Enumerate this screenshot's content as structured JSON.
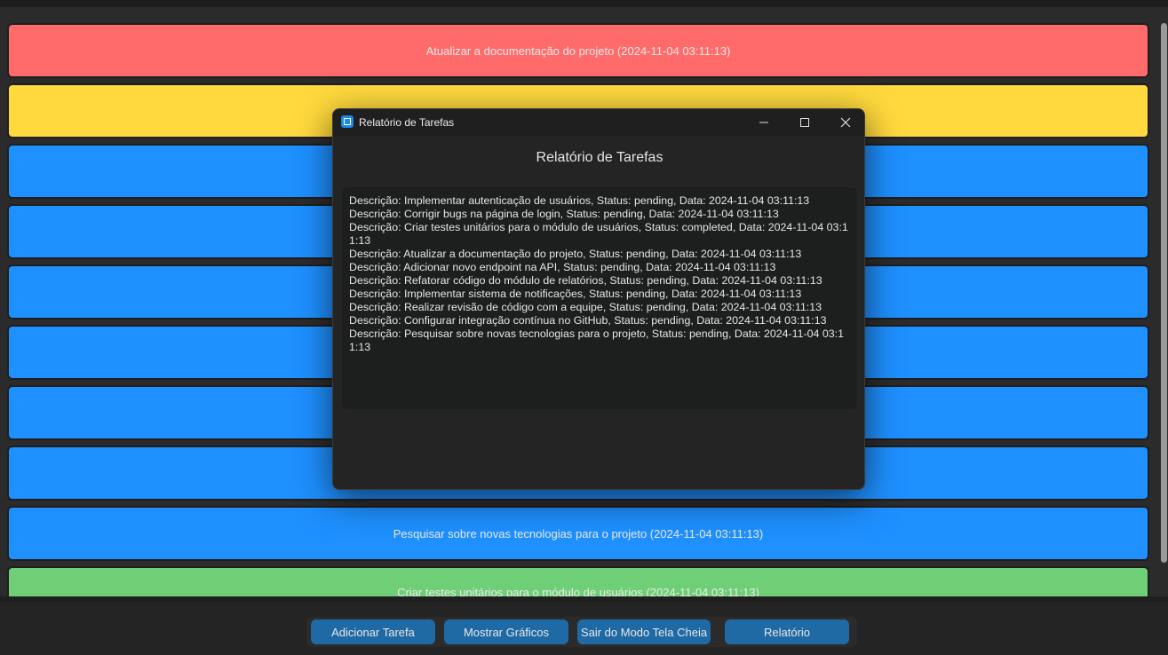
{
  "task_list": {
    "cards": [
      {
        "text": "Atualizar a documentação do projeto (2024-11-04 03:11:13)",
        "color": "#ff6b6b"
      },
      {
        "text": "",
        "color": "#ffd93d"
      },
      {
        "text": "",
        "color": "#1e90ff"
      },
      {
        "text": "",
        "color": "#1e90ff"
      },
      {
        "text": "",
        "color": "#1e90ff"
      },
      {
        "text": "",
        "color": "#1e90ff"
      },
      {
        "text": "",
        "color": "#1e90ff"
      },
      {
        "text": "",
        "color": "#1e90ff"
      },
      {
        "text": "Pesquisar sobre novas tecnologias para o projeto (2024-11-04 03:11:13)",
        "color": "#1e90ff"
      },
      {
        "text": "Criar testes unitários para o módulo de usuários (2024-11-04 03:11:13)",
        "color": "#6fcf76"
      }
    ]
  },
  "toolbar": {
    "add_task": "Adicionar Tarefa",
    "show_charts": "Mostrar Gráficos",
    "exit_fullscreen": "Sair do Modo Tela Cheia",
    "report": "Relatório"
  },
  "dialog": {
    "window_title": "Relatório de Tarefas",
    "heading": "Relatório de Tarefas",
    "minimize_icon": "minimize-icon",
    "maximize_icon": "maximize-icon",
    "close_icon": "close-icon",
    "lines": [
      "Descrição: Implementar autenticação de usuários, Status: pending, Data: 2024-11-04 03:11:13",
      "Descrição: Corrigir bugs na página de login, Status: pending, Data: 2024-11-04 03:11:13",
      "Descrição: Criar testes unitários para o módulo de usuários, Status: completed, Data: 2024-11-04 03:11:13",
      "Descrição: Atualizar a documentação do projeto, Status: pending, Data: 2024-11-04 03:11:13",
      "Descrição: Adicionar novo endpoint na API, Status: pending, Data: 2024-11-04 03:11:13",
      "Descrição: Refatorar código do módulo de relatórios, Status: pending, Data: 2024-11-04 03:11:13",
      "Descrição: Implementar sistema de notificações, Status: pending, Data: 2024-11-04 03:11:13",
      "Descrição: Realizar revisão de código com a equipe, Status: pending, Data: 2024-11-04 03:11:13",
      "Descrição: Configurar integração contínua no GitHub, Status: pending, Data: 2024-11-04 03:11:13",
      "Descrição: Pesquisar sobre novas tecnologias para o projeto, Status: pending, Data: 2024-11-04 03:11:13"
    ]
  }
}
